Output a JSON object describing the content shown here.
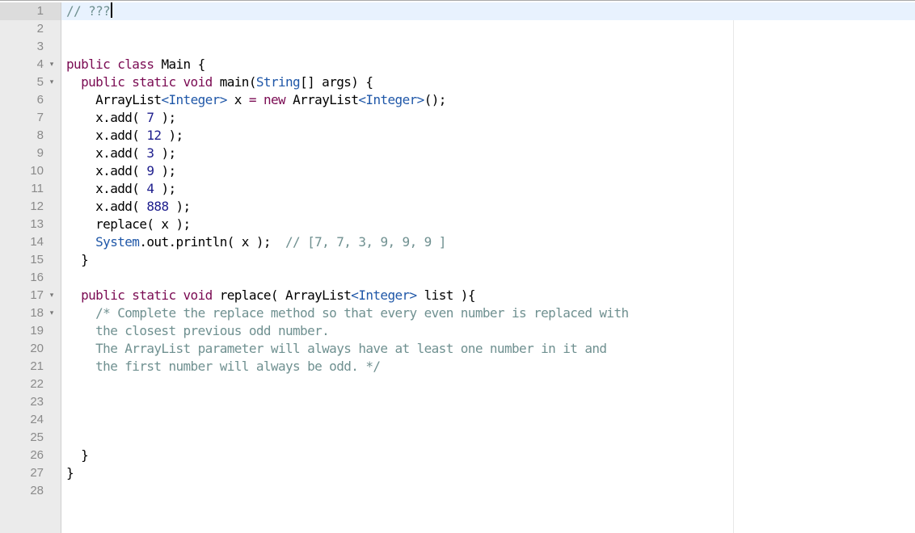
{
  "editor": {
    "language": "java",
    "active_line": 1,
    "lines": [
      {
        "n": "1",
        "fold": false,
        "tokens": [
          {
            "t": "// ???",
            "c": "comment"
          }
        ],
        "cursor": true
      },
      {
        "n": "2",
        "fold": false,
        "tokens": []
      },
      {
        "n": "3",
        "fold": false,
        "tokens": []
      },
      {
        "n": "4",
        "fold": true,
        "tokens": [
          {
            "t": "public class ",
            "c": "keyword"
          },
          {
            "t": "Main {",
            "c": "plain"
          }
        ]
      },
      {
        "n": "5",
        "fold": true,
        "tokens": [
          {
            "t": "  public static void ",
            "c": "keyword"
          },
          {
            "t": "main(",
            "c": "plain"
          },
          {
            "t": "String",
            "c": "type"
          },
          {
            "t": "[] args) {",
            "c": "plain"
          }
        ]
      },
      {
        "n": "6",
        "fold": false,
        "tokens": [
          {
            "t": "    ArrayList",
            "c": "plain"
          },
          {
            "t": "<Integer>",
            "c": "type"
          },
          {
            "t": " x ",
            "c": "plain"
          },
          {
            "t": "=",
            "c": "op"
          },
          {
            "t": " ",
            "c": "plain"
          },
          {
            "t": "new",
            "c": "keyword"
          },
          {
            "t": " ArrayList",
            "c": "plain"
          },
          {
            "t": "<Integer>",
            "c": "type"
          },
          {
            "t": "();",
            "c": "plain"
          }
        ]
      },
      {
        "n": "7",
        "fold": false,
        "tokens": [
          {
            "t": "    x.add( ",
            "c": "plain"
          },
          {
            "t": "7",
            "c": "number"
          },
          {
            "t": " );",
            "c": "plain"
          }
        ]
      },
      {
        "n": "8",
        "fold": false,
        "tokens": [
          {
            "t": "    x.add( ",
            "c": "plain"
          },
          {
            "t": "12",
            "c": "number"
          },
          {
            "t": " );",
            "c": "plain"
          }
        ]
      },
      {
        "n": "9",
        "fold": false,
        "tokens": [
          {
            "t": "    x.add( ",
            "c": "plain"
          },
          {
            "t": "3",
            "c": "number"
          },
          {
            "t": " );",
            "c": "plain"
          }
        ]
      },
      {
        "n": "10",
        "fold": false,
        "tokens": [
          {
            "t": "    x.add( ",
            "c": "plain"
          },
          {
            "t": "9",
            "c": "number"
          },
          {
            "t": " );",
            "c": "plain"
          }
        ]
      },
      {
        "n": "11",
        "fold": false,
        "tokens": [
          {
            "t": "    x.add( ",
            "c": "plain"
          },
          {
            "t": "4",
            "c": "number"
          },
          {
            "t": " );",
            "c": "plain"
          }
        ]
      },
      {
        "n": "12",
        "fold": false,
        "tokens": [
          {
            "t": "    x.add( ",
            "c": "plain"
          },
          {
            "t": "888",
            "c": "number"
          },
          {
            "t": " );",
            "c": "plain"
          }
        ]
      },
      {
        "n": "13",
        "fold": false,
        "tokens": [
          {
            "t": "    replace( x );",
            "c": "plain"
          }
        ]
      },
      {
        "n": "14",
        "fold": false,
        "tokens": [
          {
            "t": "    System",
            "c": "type"
          },
          {
            "t": ".out.println( x );  ",
            "c": "plain"
          },
          {
            "t": "// [7, 7, 3, 9, 9, 9 ]",
            "c": "comment"
          }
        ]
      },
      {
        "n": "15",
        "fold": false,
        "tokens": [
          {
            "t": "  }",
            "c": "plain"
          }
        ]
      },
      {
        "n": "16",
        "fold": false,
        "tokens": []
      },
      {
        "n": "17",
        "fold": true,
        "tokens": [
          {
            "t": "  public static void ",
            "c": "keyword"
          },
          {
            "t": "replace( ArrayList",
            "c": "plain"
          },
          {
            "t": "<Integer>",
            "c": "type"
          },
          {
            "t": " list ){",
            "c": "plain"
          }
        ]
      },
      {
        "n": "18",
        "fold": true,
        "tokens": [
          {
            "t": "    /* Complete the replace method so that every even number is replaced with",
            "c": "comment"
          }
        ]
      },
      {
        "n": "19",
        "fold": false,
        "tokens": [
          {
            "t": "    the closest previous odd number.",
            "c": "comment"
          }
        ]
      },
      {
        "n": "20",
        "fold": false,
        "tokens": [
          {
            "t": "    The ArrayList parameter will always have at least one number in it and",
            "c": "comment"
          }
        ]
      },
      {
        "n": "21",
        "fold": false,
        "tokens": [
          {
            "t": "    the first number will always be odd. */",
            "c": "comment"
          }
        ]
      },
      {
        "n": "22",
        "fold": false,
        "tokens": []
      },
      {
        "n": "23",
        "fold": false,
        "tokens": []
      },
      {
        "n": "24",
        "fold": false,
        "tokens": []
      },
      {
        "n": "25",
        "fold": false,
        "tokens": []
      },
      {
        "n": "26",
        "fold": false,
        "tokens": [
          {
            "t": "  }",
            "c": "plain"
          }
        ]
      },
      {
        "n": "27",
        "fold": false,
        "tokens": [
          {
            "t": "}",
            "c": "plain"
          }
        ]
      },
      {
        "n": "28",
        "fold": false,
        "tokens": []
      }
    ]
  },
  "icons": {
    "fold": "▾"
  }
}
